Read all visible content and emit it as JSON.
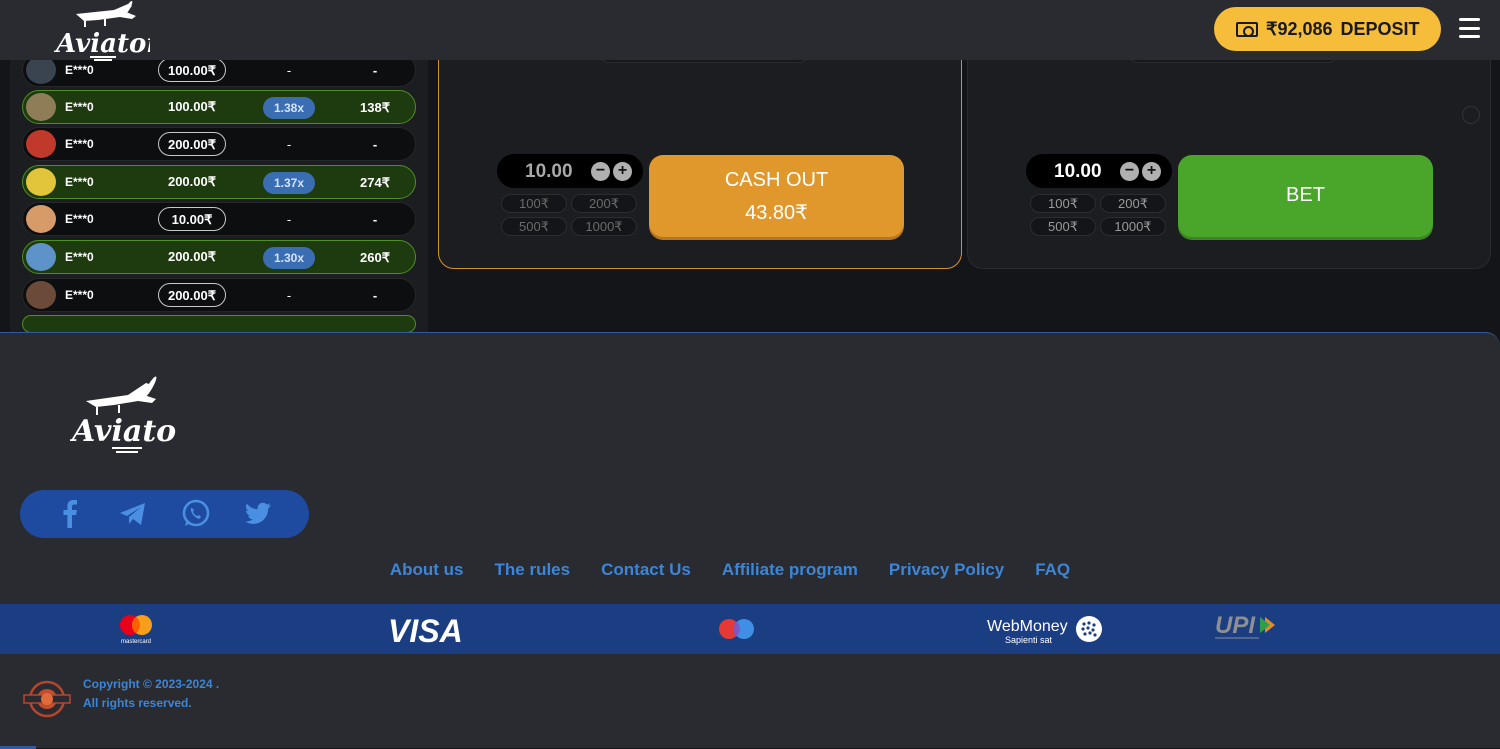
{
  "header": {
    "logo_text": "Aviator",
    "balance": "₹92,086",
    "deposit_label": "DEPOSIT"
  },
  "bets_list": [
    {
      "user": "E***0",
      "amount": "100.00₹",
      "multiplier": "-",
      "win": "-",
      "won": false,
      "avatar_color": "#3a4450"
    },
    {
      "user": "E***0",
      "amount": "100.00₹",
      "multiplier": "1.38x",
      "win": "138₹",
      "won": true,
      "avatar_color": "#8e7d57"
    },
    {
      "user": "E***0",
      "amount": "200.00₹",
      "multiplier": "-",
      "win": "-",
      "won": false,
      "avatar_color": "#c0392b"
    },
    {
      "user": "E***0",
      "amount": "200.00₹",
      "multiplier": "1.37x",
      "win": "274₹",
      "won": true,
      "avatar_color": "#e2c53a"
    },
    {
      "user": "E***0",
      "amount": "10.00₹",
      "multiplier": "-",
      "win": "-",
      "won": false,
      "avatar_color": "#d79b6a"
    },
    {
      "user": "E***0",
      "amount": "200.00₹",
      "multiplier": "1.30x",
      "win": "260₹",
      "won": true,
      "avatar_color": "#5d93c9"
    },
    {
      "user": "E***0",
      "amount": "200.00₹",
      "multiplier": "-",
      "win": "-",
      "won": false,
      "avatar_color": "#6b4a3a"
    }
  ],
  "bet_panel_1": {
    "stake": "10.00",
    "quick_amounts": [
      "100₹",
      "200₹",
      "500₹",
      "1000₹"
    ],
    "button_line1": "CASH OUT",
    "button_line2": "43.80₹"
  },
  "bet_panel_2": {
    "stake": "10.00",
    "quick_amounts": [
      "100₹",
      "200₹",
      "500₹",
      "1000₹"
    ],
    "button_label": "BET"
  },
  "footer": {
    "logo_text": "Aviator",
    "social": [
      "facebook-icon",
      "telegram-icon",
      "whatsapp-icon",
      "twitter-icon"
    ],
    "links": [
      "About us",
      "The rules",
      "Contact Us",
      "Affiliate program",
      "Privacy Policy",
      "FAQ"
    ],
    "payments": {
      "mastercard": "mastercard",
      "visa": "VISA",
      "webmoney": "WebMoney",
      "webmoney_tagline": "Sapienti sat",
      "upi": "UPI"
    },
    "copyright_line1": "Copyright © 2023-2024 .",
    "copyright_line2": "All rights reserved."
  },
  "colors": {
    "accent_yellow": "#f5bd3a",
    "cashout_orange": "#e0982d",
    "bet_green": "#4aa62b",
    "link_blue": "#3b86d8",
    "strip_blue": "#1b3e83"
  }
}
